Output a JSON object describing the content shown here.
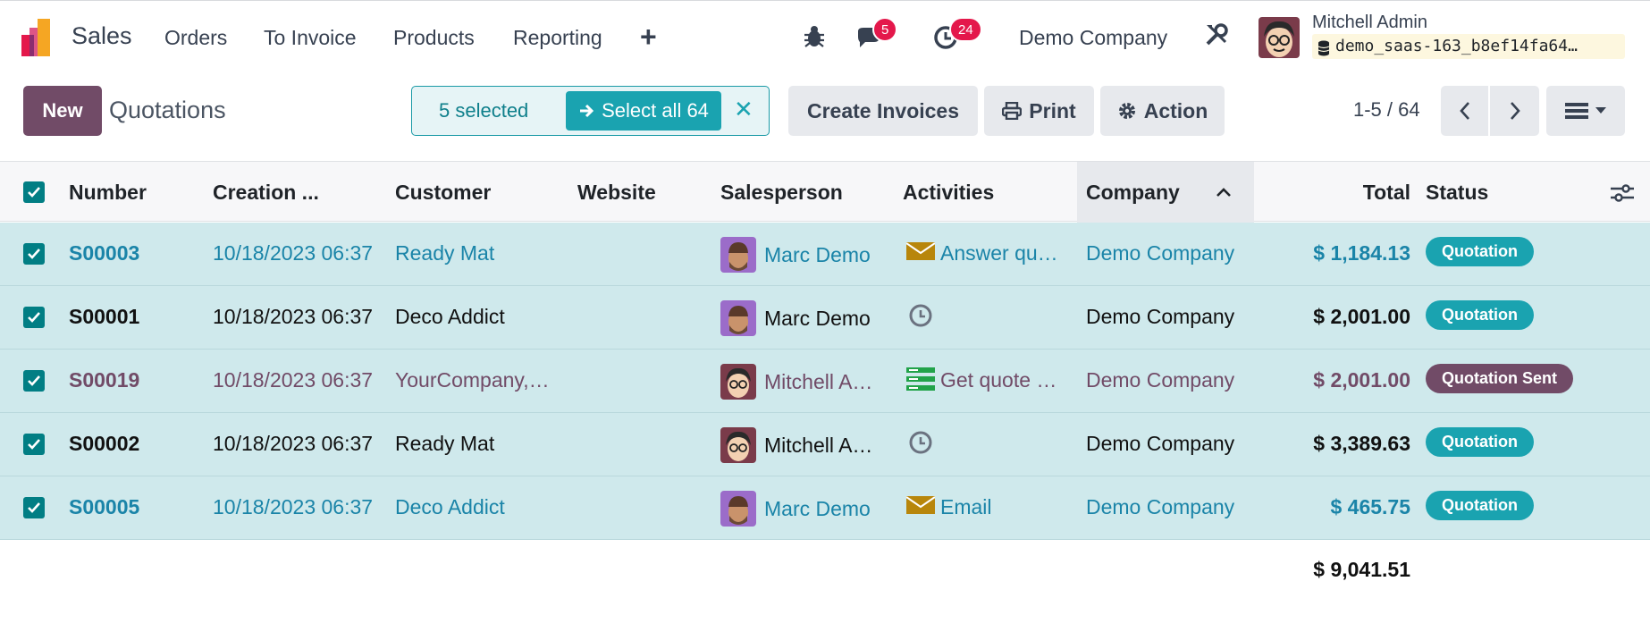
{
  "navbar": {
    "app_name": "Sales",
    "menu": [
      "Orders",
      "To Invoice",
      "Products",
      "Reporting"
    ],
    "messages_badge": "5",
    "activities_badge": "24",
    "company": "Demo Company",
    "user_name": "Mitchell Admin",
    "database": "demo_saas-163_b8ef14fa64…"
  },
  "control": {
    "new_label": "New",
    "breadcrumb": "Quotations",
    "selected_label": "5 selected",
    "select_all_label": "Select all 64",
    "create_invoices_label": "Create Invoices",
    "print_label": "Print",
    "action_label": "Action",
    "pager": "1-5 / 64"
  },
  "columns": {
    "number": "Number",
    "creation": "Creation ...",
    "customer": "Customer",
    "website": "Website",
    "salesperson": "Salesperson",
    "activities": "Activities",
    "company": "Company",
    "total": "Total",
    "status": "Status"
  },
  "rows": [
    {
      "number": "S00003",
      "date": "10/18/2023 06:37",
      "customer": "Ready Mat",
      "salesperson": "Marc Demo",
      "activity": "Answer qu…",
      "company": "Demo Company",
      "total": "$ 1,184.13",
      "status": "Quotation"
    },
    {
      "number": "S00001",
      "date": "10/18/2023 06:37",
      "customer": "Deco Addict",
      "salesperson": "Marc Demo",
      "activity": "",
      "company": "Demo Company",
      "total": "$ 2,001.00",
      "status": "Quotation"
    },
    {
      "number": "S00019",
      "date": "10/18/2023 06:37",
      "customer": "YourCompany,…",
      "salesperson": "Mitchell A…",
      "activity": "Get quote …",
      "company": "Demo Company",
      "total": "$ 2,001.00",
      "status": "Quotation Sent"
    },
    {
      "number": "S00002",
      "date": "10/18/2023 06:37",
      "customer": "Ready Mat",
      "salesperson": "Mitchell A…",
      "activity": "",
      "company": "Demo Company",
      "total": "$ 3,389.63",
      "status": "Quotation"
    },
    {
      "number": "S00005",
      "date": "10/18/2023 06:37",
      "customer": "Deco Addict",
      "salesperson": "Marc Demo",
      "activity": "Email",
      "company": "Demo Company",
      "total": "$ 465.75",
      "status": "Quotation"
    }
  ],
  "footer": {
    "sum_total": "$ 9,041.51"
  },
  "colors": {
    "brand": "#714b67",
    "teal": "#1aa3b0",
    "row_selected": "#cfe9ec",
    "badge": "#e4184b"
  }
}
